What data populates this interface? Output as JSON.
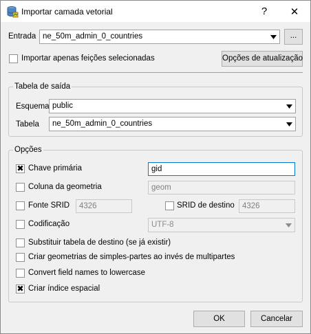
{
  "window": {
    "title": "Importar camada vetorial",
    "help_glyph": "?",
    "close_glyph": "✕"
  },
  "input_row": {
    "label": "Entrada",
    "value": "ne_50m_admin_0_countries",
    "browse_label": "..."
  },
  "import_selected": {
    "label": "Importar apenas feições selecionadas",
    "checked": false
  },
  "update_options_button": "Opções de atualização",
  "output_table": {
    "title": "Tabela de saída",
    "schema_label": "Esquema",
    "schema_value": "public",
    "table_label": "Tabela",
    "table_value": "ne_50m_admin_0_countries"
  },
  "options": {
    "title": "Opções",
    "primary_key": {
      "label": "Chave primária",
      "checked": true,
      "value": "gid"
    },
    "geometry_column": {
      "label": "Coluna da geometria",
      "checked": false,
      "value": "geom"
    },
    "source_srid": {
      "label": "Fonte SRID",
      "checked": false,
      "value": "4326"
    },
    "target_srid": {
      "label": "SRID de destino",
      "checked": false,
      "value": "4326"
    },
    "encoding": {
      "label": "Codificação",
      "checked": false,
      "value": "UTF-8"
    },
    "replace_table": {
      "label": "Substituir tabela de destino (se já existir)",
      "checked": false
    },
    "single_part": {
      "label": "Criar geometrias de simples-partes ao invés de multipartes",
      "checked": false
    },
    "lowercase": {
      "label": "Convert field names to lowercase",
      "checked": false
    },
    "spatial_index": {
      "label": "Criar índice espacial",
      "checked": true
    }
  },
  "buttons": {
    "ok": "OK",
    "cancel": "Cancelar"
  },
  "check_glyph": "✖",
  "arrow_glyph": "▼"
}
